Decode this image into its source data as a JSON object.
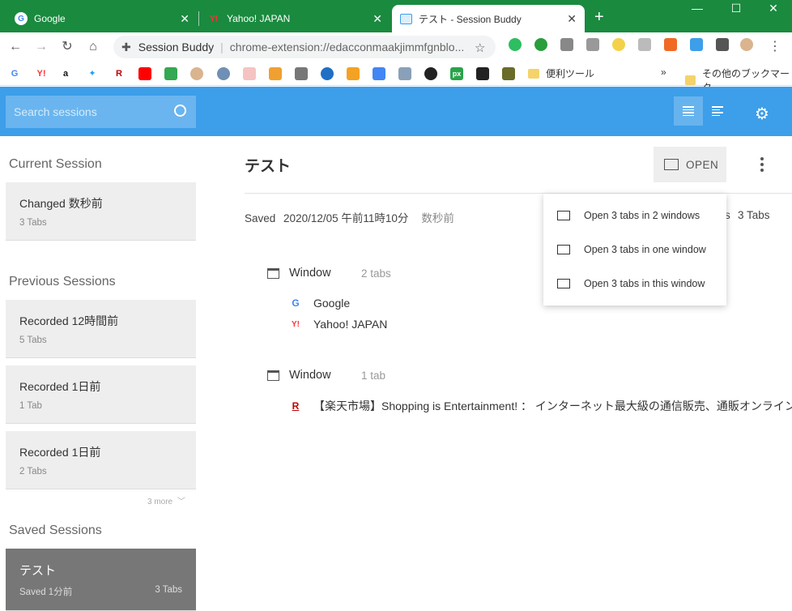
{
  "browser": {
    "tabs": [
      {
        "title": "Google",
        "active": false
      },
      {
        "title": "Yahoo! JAPAN",
        "active": false
      },
      {
        "title": "テスト - Session Buddy",
        "active": true
      }
    ],
    "address": {
      "site": "Session Buddy",
      "url": "chrome-extension://edacconmaakjimmfgnblo..."
    },
    "bookmark_folders": [
      "便利ツール",
      "その他のブックマーク"
    ],
    "overflow": "»"
  },
  "app": {
    "search_placeholder": "Search sessions",
    "colors": {
      "header": "#3d9ee9",
      "selected_card": "#777777"
    }
  },
  "sidebar": {
    "current_title": "Current Session",
    "current": {
      "title": "Changed 数秒前",
      "sub": "3 Tabs"
    },
    "previous_title": "Previous Sessions",
    "previous": [
      {
        "title": "Recorded 12時間前",
        "sub": "5 Tabs"
      },
      {
        "title": "Recorded 1日前",
        "sub": "1 Tab"
      },
      {
        "title": "Recorded 1日前",
        "sub": "2 Tabs"
      }
    ],
    "more_label": "3 more",
    "saved_title": "Saved Sessions",
    "saved": {
      "title": "テスト",
      "sub": "Saved 1分前",
      "count": "3 Tabs"
    }
  },
  "main": {
    "title": "テスト",
    "open_label": "OPEN",
    "saved_label": "Saved",
    "saved_date": "2020/12/05 午前11時10分",
    "saved_ago": "数秒前",
    "tab_count_partial": "s",
    "tab_count": "3 Tabs",
    "windows": [
      {
        "label": "Window",
        "count": "2 tabs",
        "tabs": [
          {
            "icon": "G",
            "title": "Google"
          },
          {
            "icon": "Y!",
            "title": "Yahoo! JAPAN"
          }
        ]
      },
      {
        "label": "Window",
        "count": "1 tab",
        "tabs": [
          {
            "icon": "R",
            "title": "【楽天市場】Shopping is Entertainment! ： インターネット最大級の通信販売、通販オンライン"
          }
        ]
      }
    ]
  },
  "menu": {
    "items": [
      {
        "pre": "Open 3 tabs in ",
        "bold": "2 windows"
      },
      {
        "pre": "Open 3 tabs in ",
        "bold": "one window"
      },
      {
        "pre": "Open 3 tabs in ",
        "bold": "this window"
      }
    ]
  }
}
